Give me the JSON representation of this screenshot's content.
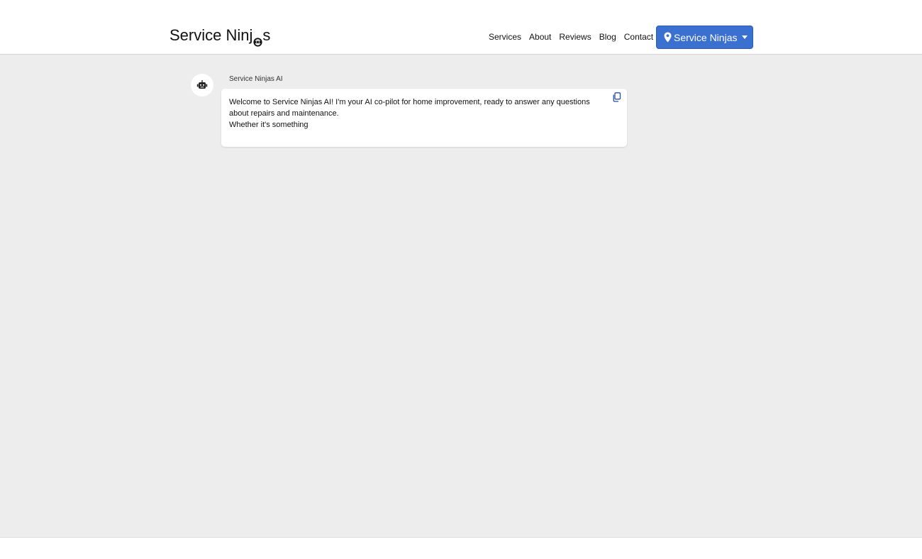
{
  "header": {
    "logo_prefix": "Service Ninj",
    "logo_suffix": "s",
    "logo_icon": "ninja-mask-icon",
    "nav": [
      {
        "label": "Services"
      },
      {
        "label": "About"
      },
      {
        "label": "Reviews"
      },
      {
        "label": "Blog"
      },
      {
        "label": "Contact"
      }
    ],
    "location_button": {
      "label": "Service Ninjas",
      "icon": "map-pin-icon",
      "color": "#3a70d0"
    }
  },
  "chat": {
    "messages": [
      {
        "sender": "Service Ninjas AI",
        "avatar_icon": "robot-icon",
        "lines": [
          "Welcome to Service Ninjas AI! I'm your AI co-pilot for home improvement, ready to answer any questions about repairs and maintenance.",
          "Whether it's something"
        ],
        "copy_icon": "copy-icon"
      }
    ]
  },
  "colors": {
    "background": "#ededed",
    "accent": "#3a70d0"
  }
}
